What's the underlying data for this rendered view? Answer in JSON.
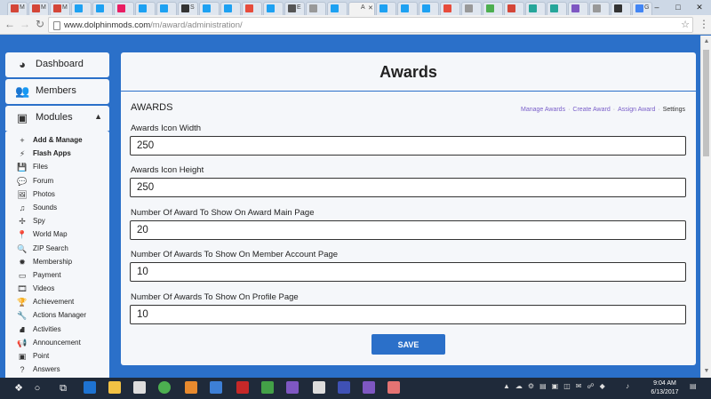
{
  "browser": {
    "url_host": "www.dolphinmods.com",
    "url_path": "/m/award/administration/",
    "active_tab_title": "A",
    "tabs": [
      {
        "title": "M",
        "color": "#d44638"
      },
      {
        "title": "M",
        "color": "#d44638"
      },
      {
        "title": "M",
        "color": "#d44638"
      },
      {
        "title": "",
        "color": "#1da1f2"
      },
      {
        "title": "",
        "color": "#1da1f2"
      },
      {
        "title": "",
        "color": "#e91e63"
      },
      {
        "title": "",
        "color": "#1da1f2"
      },
      {
        "title": "",
        "color": "#1da1f2"
      },
      {
        "title": "S",
        "color": "#333333"
      },
      {
        "title": "",
        "color": "#1da1f2"
      },
      {
        "title": "",
        "color": "#1da1f2"
      },
      {
        "title": "",
        "color": "#e74c3c"
      },
      {
        "title": "",
        "color": "#1da1f2"
      },
      {
        "title": "E",
        "color": "#555555"
      },
      {
        "title": "",
        "color": "#999999"
      },
      {
        "title": "",
        "color": "#1da1f2"
      },
      {
        "title": "",
        "color": "#1da1f2"
      },
      {
        "title": "",
        "color": "#1da1f2"
      },
      {
        "title": "",
        "color": "#1da1f2"
      },
      {
        "title": "",
        "color": "#e74c3c"
      },
      {
        "title": "",
        "color": "#999999"
      },
      {
        "title": "",
        "color": "#4caf50"
      },
      {
        "title": "",
        "color": "#d44638"
      },
      {
        "title": "",
        "color": "#26a69a"
      },
      {
        "title": "",
        "color": "#26a69a"
      },
      {
        "title": "",
        "color": "#7e57c2"
      },
      {
        "title": "",
        "color": "#999999"
      },
      {
        "title": "",
        "color": "#333333"
      },
      {
        "title": "G",
        "color": "#4285f4"
      }
    ]
  },
  "sidebar": {
    "dashboard": {
      "label": "Dashboard",
      "icon": "tachometer-icon"
    },
    "members": {
      "label": "Members",
      "icon": "users-icon"
    },
    "modules": {
      "label": "Modules",
      "icon": "puzzle-icon"
    },
    "module_items": [
      {
        "label": "Add & Manage",
        "icon": "plus-icon",
        "glyph": "+",
        "bold": true
      },
      {
        "label": "Flash Apps",
        "icon": "bolt-icon",
        "glyph": "⚡",
        "bold": true
      },
      {
        "label": "Files",
        "icon": "save-icon",
        "glyph": "💾",
        "bold": false
      },
      {
        "label": "Forum",
        "icon": "comments-icon",
        "glyph": "💬",
        "bold": false
      },
      {
        "label": "Photos",
        "icon": "photo-icon",
        "glyph": "🖼",
        "bold": false
      },
      {
        "label": "Sounds",
        "icon": "music-icon",
        "glyph": "♫",
        "bold": false
      },
      {
        "label": "Spy",
        "icon": "crosshair-icon",
        "glyph": "✢",
        "bold": false
      },
      {
        "label": "World Map",
        "icon": "map-marker-icon",
        "glyph": "📍",
        "bold": false
      },
      {
        "label": "ZIP Search",
        "icon": "search-icon",
        "glyph": "🔍",
        "bold": false
      },
      {
        "label": "Membership",
        "icon": "certificate-icon",
        "glyph": "✹",
        "bold": false
      },
      {
        "label": "Payment",
        "icon": "credit-card-icon",
        "glyph": "▭",
        "bold": false
      },
      {
        "label": "Videos",
        "icon": "film-icon",
        "glyph": "🎞",
        "bold": false
      },
      {
        "label": "Achievement",
        "icon": "trophy-icon",
        "glyph": "🏆",
        "bold": false
      },
      {
        "label": "Actions Manager",
        "icon": "wrench-icon",
        "glyph": "🔧",
        "bold": false
      },
      {
        "label": "Activities",
        "icon": "road-icon",
        "glyph": "⛘",
        "bold": false
      },
      {
        "label": "Announcement",
        "icon": "bullhorn-icon",
        "glyph": "📢",
        "bold": false
      },
      {
        "label": "Point",
        "icon": "money-icon",
        "glyph": "▣",
        "bold": false
      },
      {
        "label": "Answers",
        "icon": "question-circle-icon",
        "glyph": "?",
        "bold": false
      }
    ]
  },
  "main": {
    "title": "Awards",
    "section_title": "AWARDS",
    "subnav": {
      "manage": "Manage Awards",
      "create": "Create Award",
      "assign": "Assign Award",
      "settings": "Settings",
      "separator": "·"
    },
    "fields": {
      "icon_width": {
        "label": "Awards Icon Width",
        "value": "250"
      },
      "icon_height": {
        "label": "Awards Icon Height",
        "value": "250"
      },
      "main_page": {
        "label": "Number Of Award To Show On Award Main Page",
        "value": "20"
      },
      "account_page": {
        "label": "Number Of Awards To Show On Member Account Page",
        "value": "10"
      },
      "profile_page": {
        "label": "Number Of Awards To Show On Profile Page",
        "value": "10"
      }
    },
    "save_label": "SAVE"
  },
  "taskbar": {
    "time": "9:04 AM",
    "date": "6/13/2017"
  },
  "colors": {
    "brand_blue": "#2b70c9",
    "link_purple": "#7a5fc9",
    "panel_bg": "#f5f7fa"
  }
}
